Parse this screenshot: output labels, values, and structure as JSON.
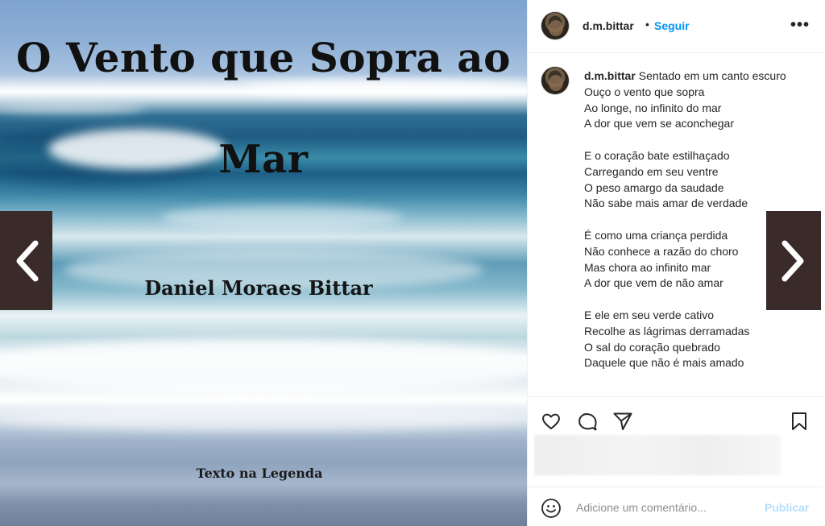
{
  "post": {
    "cover": {
      "title_line1": "O Vento que Sopra ao",
      "title_line2": "Mar",
      "author": "Daniel Moraes Bittar",
      "footer": "Texto na Legenda"
    }
  },
  "header": {
    "username": "d.m.bittar",
    "separator": "•",
    "follow_label": "Seguir",
    "more_label": "•••"
  },
  "caption": {
    "username": "d.m.bittar",
    "first_line": "Sentado em um canto escuro",
    "stanza1": [
      "Ouço o vento que sopra",
      "Ao longe, no infinito do mar",
      "A dor que vem se aconchegar"
    ],
    "stanza2": [
      "E o coração bate estilhaçado",
      "Carregando em seu ventre",
      "O peso amargo da saudade",
      "Não sabe mais amar de verdade"
    ],
    "stanza3": [
      "É como uma criança perdida",
      "Não conhece a razão do choro",
      "Mas chora ao infinito mar",
      "A dor que vem de não amar"
    ],
    "stanza4": [
      "E ele em seu verde cativo",
      "Recolhe as lágrimas derramadas",
      "O sal do coração quebrado",
      "Daquele que não é mais amado"
    ]
  },
  "actions": {
    "icons": [
      "heart-icon",
      "comment-icon",
      "share-icon",
      "bookmark-icon"
    ]
  },
  "comment": {
    "placeholder": "Adicione um comentário...",
    "publish_label": "Publicar"
  },
  "colors": {
    "accent": "#0095f6",
    "publish_disabled": "#b2dffc",
    "nav_bg": "#3a2a2a"
  }
}
